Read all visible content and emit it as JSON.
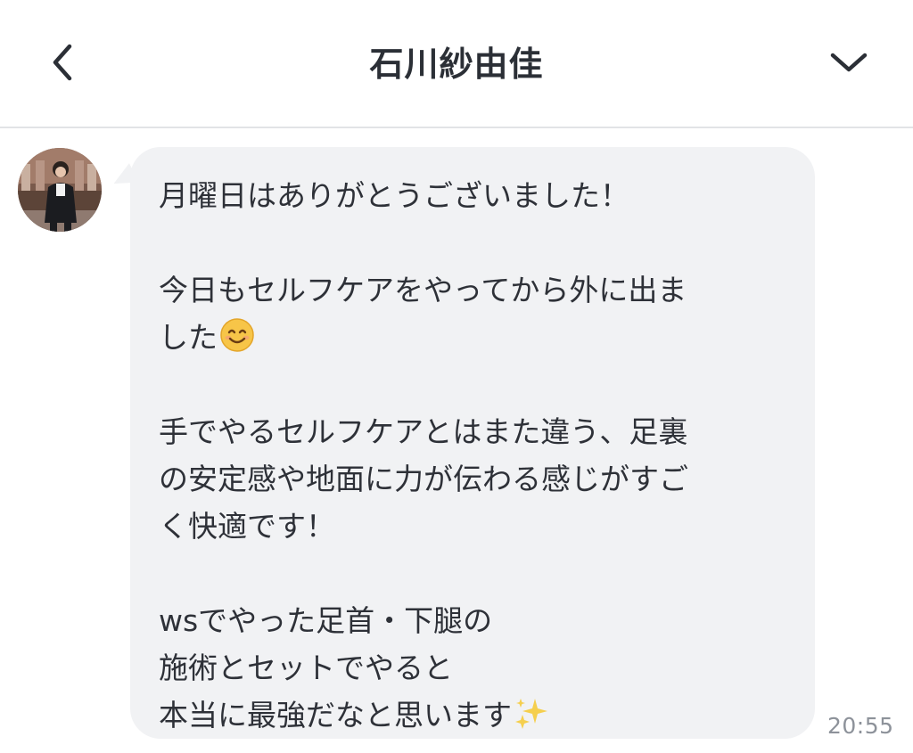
{
  "header": {
    "back_icon": "chevron-left-icon",
    "title": "石川紗由佳",
    "menu_icon": "chevron-down-icon"
  },
  "message": {
    "avatar": "person-photo-avatar",
    "lines": [
      "月曜日はありがとうございました！",
      "",
      "今日もセルフケアをやってから外に出ま",
      "した",
      "",
      "手でやるセルフケアとはまた違う、足裏",
      "の安定感や地面に力が伝わる感じがすご",
      "く快適です！",
      "",
      "wsでやった足首・下腿の",
      "施術とセットでやると",
      "本当に最強だなと思います"
    ],
    "emoji_smile": "smiling-face-emoji",
    "emoji_sparkles": "sparkles-emoji",
    "time": "20:55"
  },
  "colors": {
    "bubble": "#f1f2f4",
    "text": "#2e3138",
    "timestamp": "#8d929a",
    "divider": "#e2e3e6"
  }
}
